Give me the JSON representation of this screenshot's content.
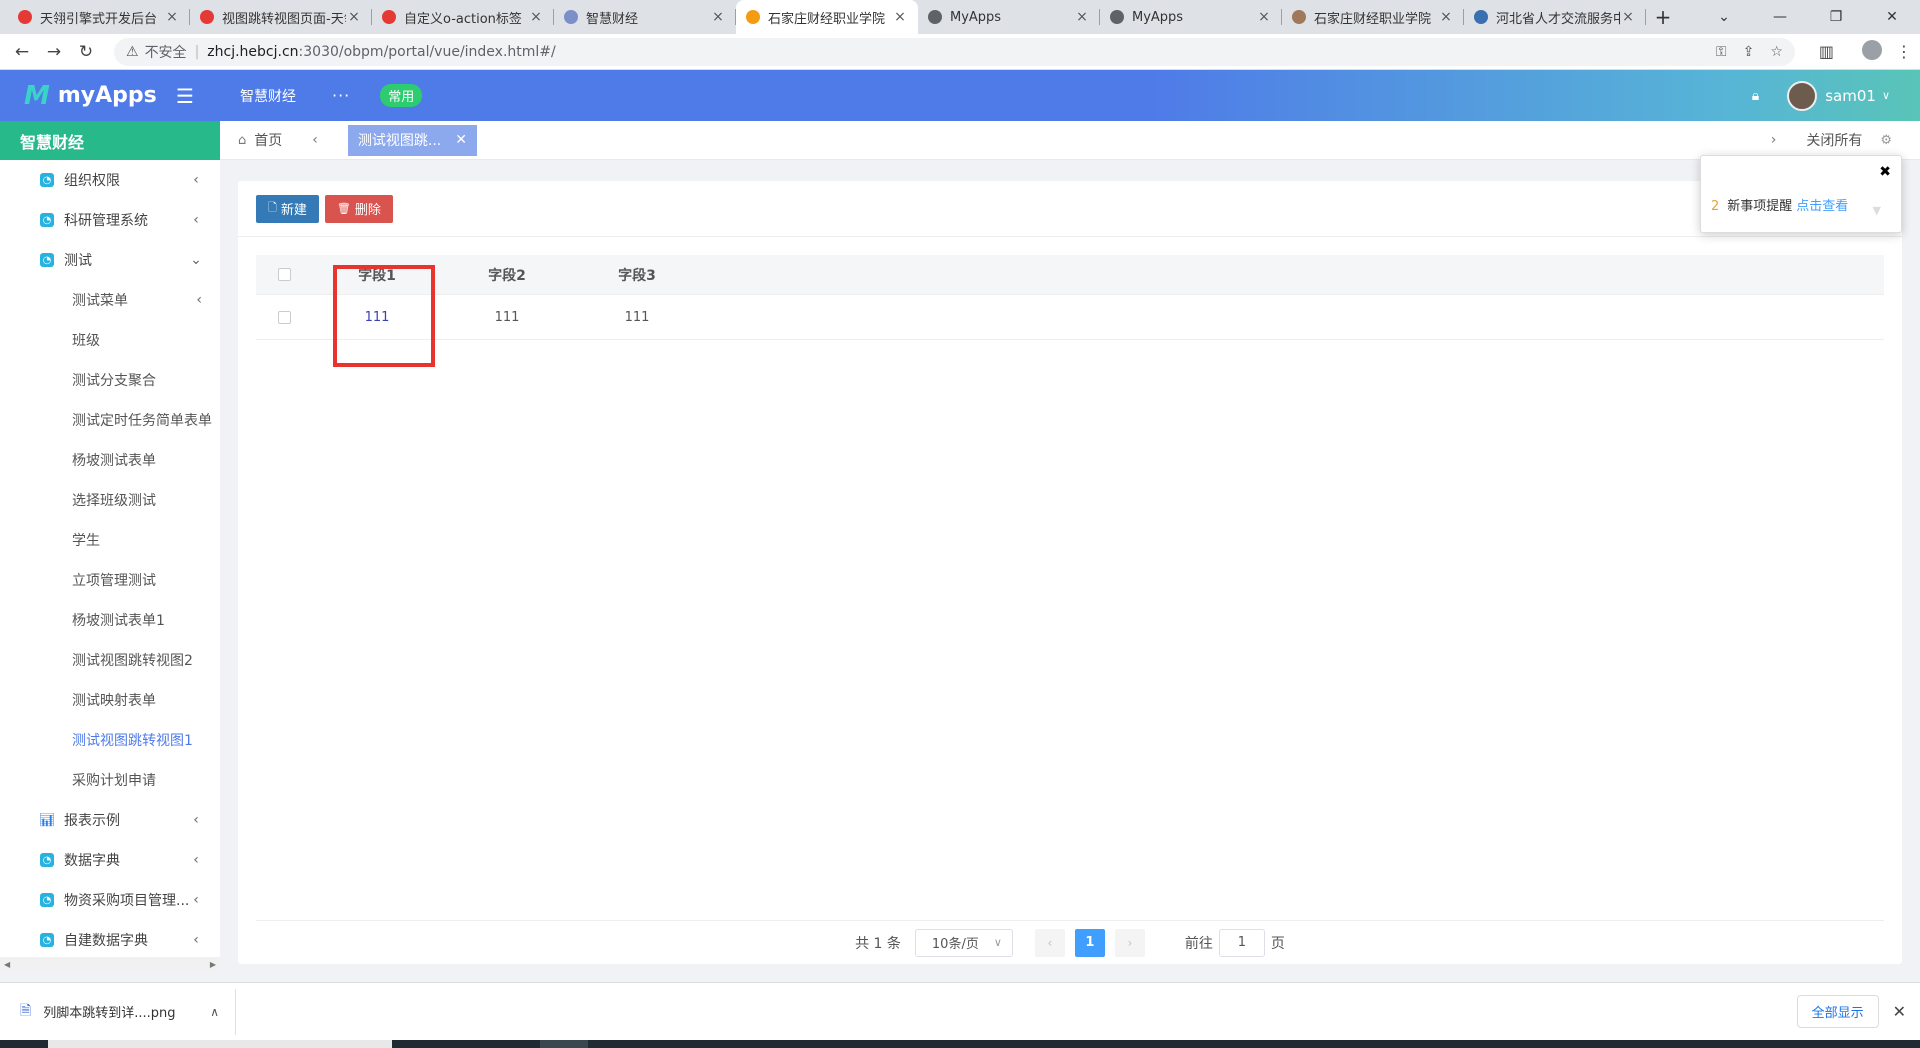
{
  "browser": {
    "tabs": [
      {
        "title": "天翎引擎式开发后台",
        "favicon_color": "#e53935",
        "active": false
      },
      {
        "title": "视图跳转视图页面-天翎",
        "favicon_color": "#e53935",
        "active": false
      },
      {
        "title": "自定义o-action标签",
        "favicon_color": "#e53935",
        "active": false
      },
      {
        "title": "智慧财经",
        "favicon_color": "#7b8fc9",
        "active": false
      },
      {
        "title": "石家庄财经职业学院",
        "favicon_color": "#f39c12",
        "active": true
      },
      {
        "title": "MyApps",
        "favicon_color": "#5f6368",
        "active": false
      },
      {
        "title": "MyApps",
        "favicon_color": "#5f6368",
        "active": false
      },
      {
        "title": "石家庄财经职业学院",
        "favicon_color": "#a0785a",
        "active": false
      },
      {
        "title": "河北省人才交流服务中",
        "favicon_color": "#3a6fb0",
        "active": false
      }
    ],
    "new_tab": "+",
    "tab_close": "×",
    "address": {
      "insecure_label": "不安全",
      "host": "zhcj.hebcj.cn",
      "path": ":3030/obpm/portal/vue/index.html#/"
    }
  },
  "header": {
    "logo_mark": "M",
    "logo_text": "myApps",
    "app_name": "智慧财经",
    "more": "···",
    "common_pill": "常用",
    "user_name": "sam01"
  },
  "sidebar": {
    "title": "智慧财经",
    "items": [
      {
        "label": "组织权限",
        "arrow": "‹"
      },
      {
        "label": "科研管理系统",
        "arrow": "‹"
      },
      {
        "label": "测试",
        "arrow": "⌄"
      }
    ],
    "sub_items": [
      {
        "label": "测试菜单",
        "arrow": "‹"
      },
      {
        "label": "班级"
      },
      {
        "label": "测试分支聚合"
      },
      {
        "label": "测试定时任务简单表单"
      },
      {
        "label": "杨坡测试表单"
      },
      {
        "label": "选择班级测试"
      },
      {
        "label": "学生"
      },
      {
        "label": "立项管理测试"
      },
      {
        "label": "杨坡测试表单1"
      },
      {
        "label": "测试视图跳转视图2"
      },
      {
        "label": "测试映射表单"
      },
      {
        "label": "测试视图跳转视图1",
        "active": true
      },
      {
        "label": "采购计划申请"
      }
    ],
    "bottom_items": [
      {
        "label": "报表示例",
        "arrow": "‹",
        "icon": "chart-icon"
      },
      {
        "label": "数据字典",
        "arrow": "‹"
      },
      {
        "label": "物资采购项目管理...",
        "arrow": "‹"
      },
      {
        "label": "自建数据字典",
        "arrow": "‹"
      }
    ]
  },
  "page_tabs": {
    "home": "首页",
    "active_tab": "测试视图跳...",
    "close_all": "关闭所有"
  },
  "toolbar": {
    "new_label": "新建",
    "delete_label": "删除"
  },
  "grid": {
    "columns": [
      "字段1",
      "字段2",
      "字段3"
    ],
    "rows": [
      [
        "111",
        "111",
        "111"
      ]
    ]
  },
  "pager": {
    "total": "共 1 条",
    "page_size": "10条/页",
    "current_page": "1",
    "goto_label": "前往",
    "goto_value": "1",
    "page_suffix": "页"
  },
  "notification": {
    "count": "2",
    "text": "新事项提醒",
    "link": "点击查看"
  },
  "download_bar": {
    "file_name": "列脚本跳转到详....png",
    "show_all": "全部显示"
  }
}
